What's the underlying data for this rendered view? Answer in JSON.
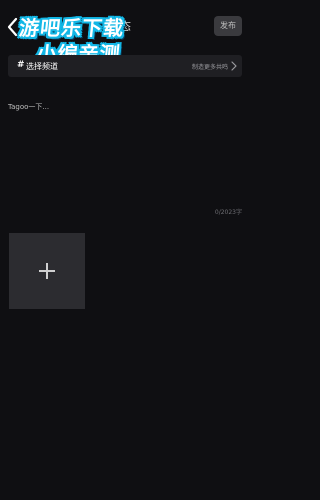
{
  "header": {
    "back_icon": "chevron-left-icon",
    "title_fragment": "态",
    "publish_label": "发布"
  },
  "watermark": {
    "line1": "游吧乐下载",
    "line2": "小编亲测",
    "outline_color": "#12b7e6"
  },
  "channel": {
    "hash_icon": "#",
    "label": "选择频道",
    "hint": "制造更多共鸣",
    "chevron_icon": "chevron-right-icon"
  },
  "composer": {
    "placeholder": "Tagoo一下...",
    "word_count": "0/2023字"
  },
  "media": {
    "add_icon": "plus-icon"
  },
  "colors": {
    "background": "#0f0f12",
    "bar": "#1f1f23",
    "tile": "#2c2c30"
  }
}
